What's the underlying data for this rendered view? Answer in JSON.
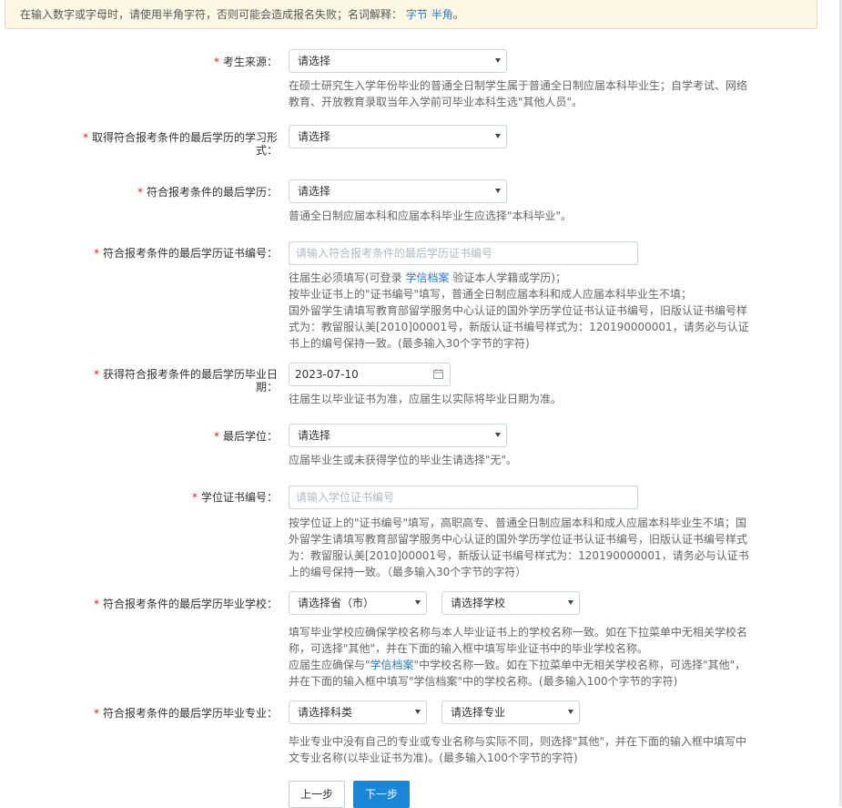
{
  "notice": {
    "text": "在输入数字或字母时，请使用半角字符，否则可能会造成报名失败；名词解释：",
    "link1": "字节",
    "link2": "半角",
    "end": "。"
  },
  "fields": {
    "source": {
      "label": "考生来源：",
      "select": "请选择",
      "help": "在硕士研究生入学年份毕业的普通全日制学生属于普通全日制应届本科毕业生；自学考试、网络教育、开放教育录取当年入学前可毕业本科生选\"其他人员\"。"
    },
    "study_form": {
      "label": "取得符合报考条件的最后学历的学习形式：",
      "select": "请选择"
    },
    "education": {
      "label": "符合报考条件的最后学历：",
      "select": "请选择",
      "help": "普通全日制应届本科和应届本科毕业生应选择\"本科毕业\"。"
    },
    "cert_no": {
      "label": "符合报考条件的最后学历证书编号：",
      "placeholder": "请输入符合报考条件的最后学历证书编号",
      "help_1a": "往届生必须填写(可登录 ",
      "help_1link": "学信档案",
      "help_1b": " 验证本人学籍或学历)；",
      "help_2": "按毕业证书上的\"证书编号\"填写，普通全日制应届本科和成人应届本科毕业生不填；",
      "help_3": "国外留学生请填写教育部留学服务中心认证的国外学历学位证书认证书编号，旧版认证书编号样式为：教留服认美[2010]00001号，新版认证书编号样式为：120190000001，请务必与认证书上的编号保持一致。(最多输入30个字节的字符)"
    },
    "grad_date": {
      "label": "获得符合报考条件的最后学历毕业日期：",
      "value": "2023-07-10",
      "help": "往届生以毕业证书为准，应届生以实际将毕业日期为准。"
    },
    "degree": {
      "label": "最后学位：",
      "select": "请选择",
      "help": "应届毕业生或未获得学位的毕业生请选择\"无\"。"
    },
    "degree_no": {
      "label": "学位证书编号：",
      "placeholder": "请输入学位证书编号",
      "help": "按学位证上的\"证书编号\"填写，高职高专、普通全日制应届本科和成人应届本科毕业生不填；国外留学生请填写教育部留学服务中心认证的国外学历学位证书认证书编号，旧版认证书编号样式为：教留服认美[2010]00001号，新版认证书编号样式为：120190000001，请务必与认证书上的编号保持一致。（最多输入30个字节的字符）"
    },
    "school": {
      "label": "符合报考条件的最后学历毕业学校：",
      "select_province": "请选择省（市）",
      "select_school": "请选择学校",
      "help_1": "填写毕业学校应确保学校名称与本人毕业证书上的学校名称一致。如在下拉菜单中无相关学校名称，可选择\"其他\"，并在下面的输入框中填写毕业证书中的毕业学校名称。",
      "help_2a": "应届生应确保与\"",
      "help_2link": "学信档案",
      "help_2b": "\"中学校名称一致。如在下拉菜单中无相关学校名称，可选择\"其他\"，并在下面的输入框中填写\"学信档案\"中的学校名称。(最多输入100个字节的字符)"
    },
    "major": {
      "label": "符合报考条件的最后学历毕业专业：",
      "select_category": "请选择科类",
      "select_major": "请选择专业",
      "help": "毕业专业中没有自己的专业或专业名称与实际不同，则选择\"其他\"，并在下面的输入框中填写中文专业名称(以毕业证书为准)。(最多输入100个字节的字符)"
    }
  },
  "buttons": {
    "prev": "上一步",
    "next": "下一步"
  },
  "colors": {
    "required_star": "#e02020",
    "link": "#2a7ac7",
    "primary_button": "#1a86d8",
    "notice_bg": "#fcf8e3"
  }
}
